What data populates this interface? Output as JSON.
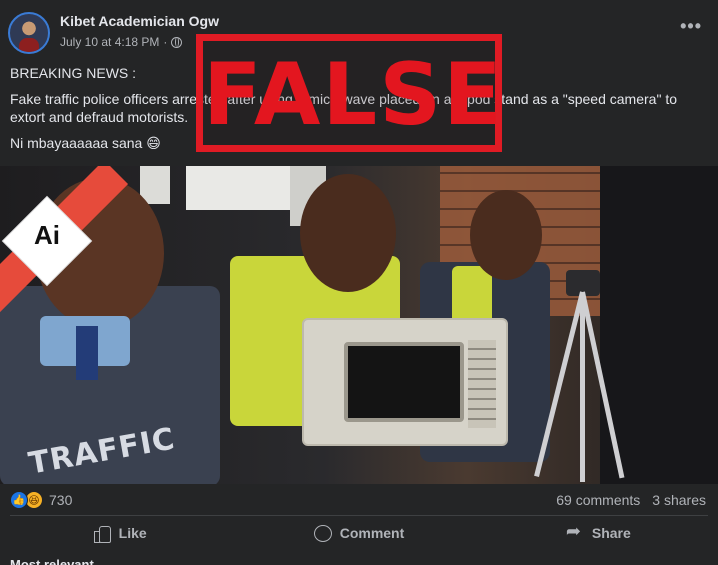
{
  "post": {
    "author": "Kibet Academician Ogw",
    "timestamp": "July 10 at 4:18 PM",
    "separator": "·",
    "privacy_icon": "globe-icon",
    "more_label": "•••",
    "body": {
      "headline": "BREAKING NEWS :",
      "paragraph": "Fake traffic police officers arrested after using a microwave placed on a tripod stand as a \"speed camera\" to extort and defraud motorists.",
      "comment_line": "Ni mbayaaaaaa  sana 😄"
    },
    "stamp": {
      "label": "FALSE",
      "color": "#e01b24"
    },
    "image": {
      "badge_label": "Ai",
      "vest_text": "TRAFFIC",
      "band_color": "#e64b3b"
    }
  },
  "engagement": {
    "reaction_icons": [
      "like-icon",
      "haha-icon"
    ],
    "reaction_count": "730",
    "comments": "69 comments",
    "shares": "3 shares"
  },
  "actions": {
    "like": "Like",
    "comment": "Comment",
    "share": "Share"
  },
  "footer": {
    "partial_label": "Most relevant"
  },
  "colors": {
    "background": "#242526",
    "text": "#e4e6eb",
    "muted": "#b0b3b8",
    "accent": "#1b74e4"
  }
}
